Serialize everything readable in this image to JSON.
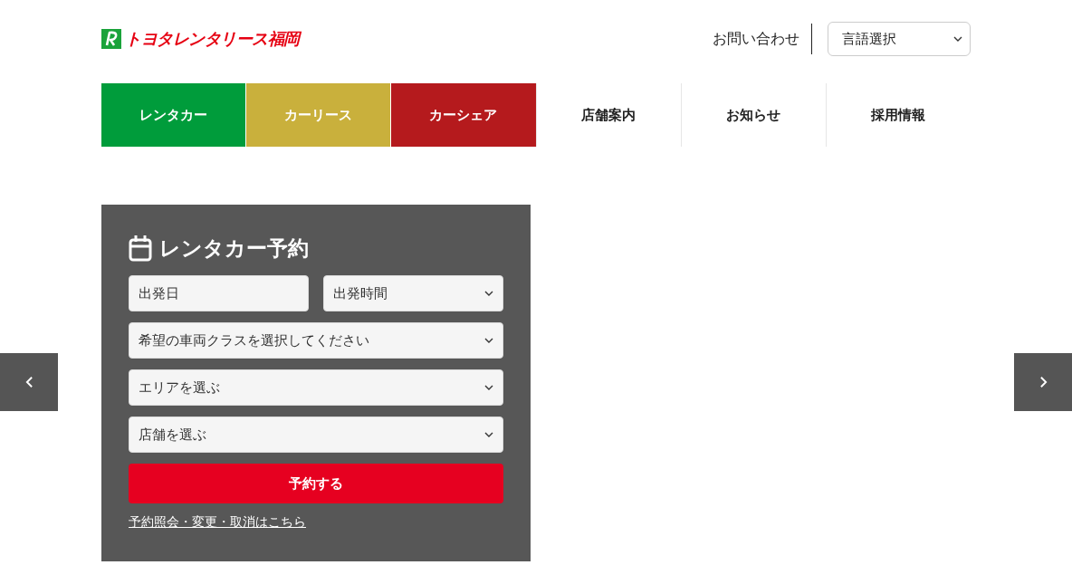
{
  "header": {
    "logo_text": "トヨタレンタリース福岡",
    "contact_link": "お問い合わせ",
    "language_select": {
      "value": "言語選択"
    }
  },
  "nav": [
    {
      "label": "レンタカー",
      "color": "#009c3b"
    },
    {
      "label": "カーリース",
      "color": "#c9b03c"
    },
    {
      "label": "カーシェア",
      "color": "#b51a1d"
    },
    {
      "label": "店舗案内"
    },
    {
      "label": "お知らせ"
    },
    {
      "label": "採用情報"
    }
  ],
  "booking": {
    "title": "レンタカー予約",
    "fields": [
      {
        "kind": "input",
        "placeholder": "出発日"
      },
      {
        "kind": "select",
        "value": "出発時間"
      },
      {
        "kind": "select",
        "value": "希望の車両クラスを選択してください"
      },
      {
        "kind": "select",
        "value": "エリアを選ぶ"
      },
      {
        "kind": "select",
        "value": "店舗を選ぶ"
      }
    ],
    "submit": "予約する",
    "link": "予約照会・変更・取消はこちら"
  }
}
